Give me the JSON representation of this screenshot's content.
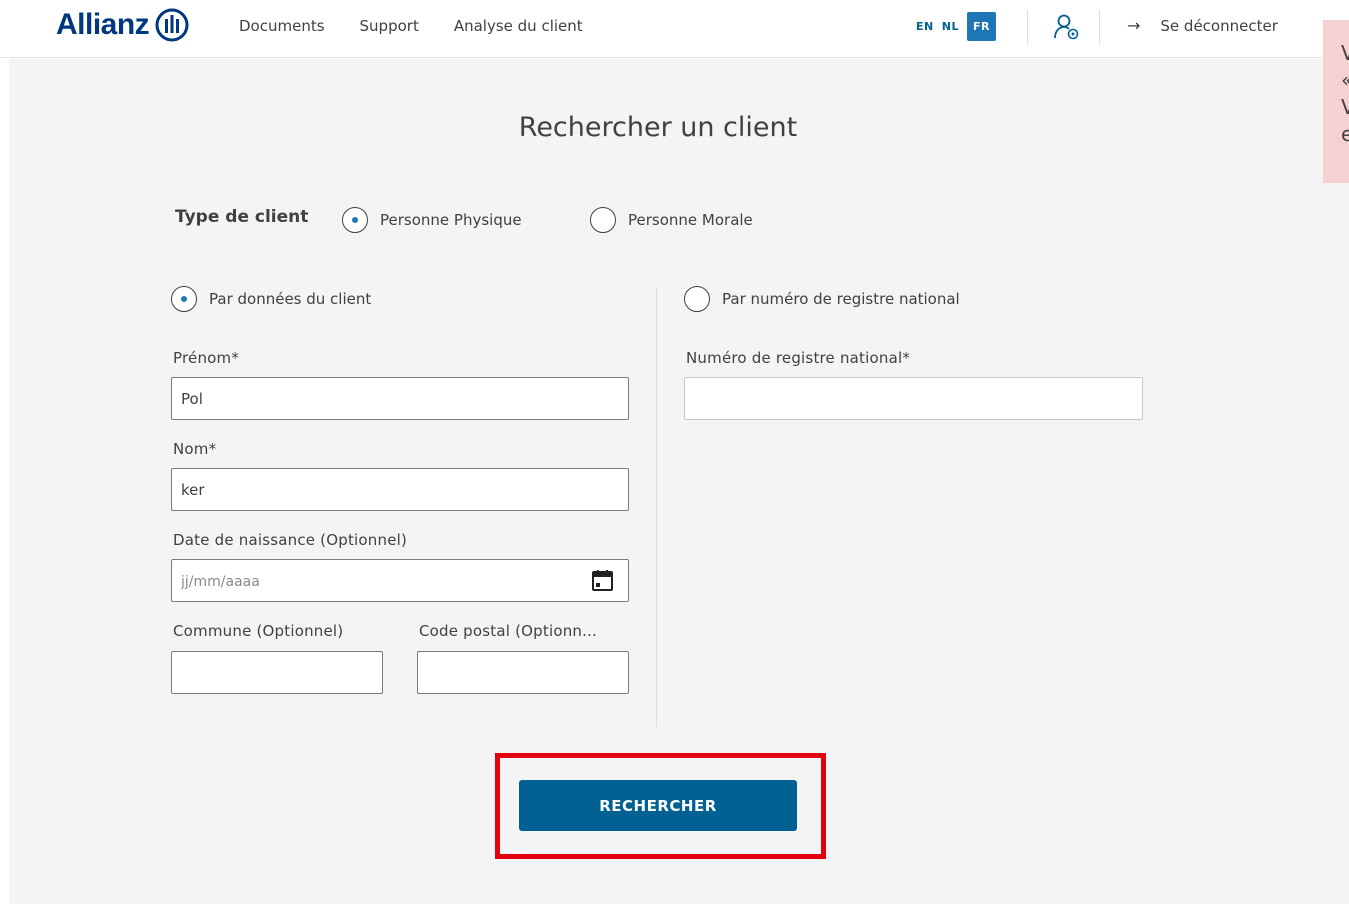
{
  "header": {
    "logo_text": "Allianz",
    "nav": [
      "Documents",
      "Support",
      "Analyse du client"
    ],
    "languages": [
      "EN",
      "NL",
      "FR"
    ],
    "active_language": "FR",
    "logout_arrow": "→",
    "logout_label": "Se déconnecter"
  },
  "title": "Rechercher un client",
  "client_type": {
    "label": "Type de client",
    "options": [
      "Personne Physique",
      "Personne Morale"
    ],
    "selected": "Personne Physique"
  },
  "search_mode": {
    "by_data": "Par données du client",
    "by_register": "Par numéro de registre national",
    "selected": "Par données du client"
  },
  "fields": {
    "first_name": {
      "label": "Prénom*",
      "value": "Pol"
    },
    "last_name": {
      "label": "Nom*",
      "value": "ker"
    },
    "birth_date": {
      "label": "Date de naissance (Optionnel)",
      "placeholder": "jj/mm/aaaa"
    },
    "municipality": {
      "label": "Commune (Optionnel)",
      "value": ""
    },
    "postal_code": {
      "label": "Code postal (Optionn...",
      "value": ""
    },
    "register_number": {
      "label": "Numéro de registre national*",
      "value": ""
    }
  },
  "search_button": "RECHERCHER",
  "tooltip_text": [
    "V",
    "«",
    "V",
    "e"
  ],
  "colors": {
    "brand": "#003781",
    "primary": "#006192",
    "highlight": "#e3000f"
  }
}
